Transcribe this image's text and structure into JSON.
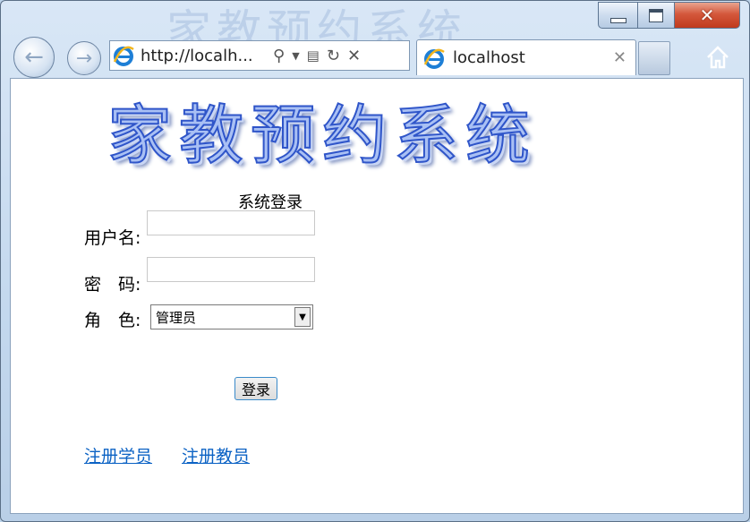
{
  "window": {
    "ghost_title": "家教预约系统",
    "controls": {
      "minimize": "minimize",
      "maximize": "maximize",
      "close": "✕"
    }
  },
  "browser": {
    "address": "http://localh...",
    "tab_title": "localhost",
    "icons": [
      "back-arrow-icon",
      "forward-arrow-icon",
      "ie-logo-icon",
      "search-icon",
      "dropdown-icon",
      "compatibility-icon",
      "refresh-icon",
      "stop-icon",
      "close-icon",
      "home-icon"
    ]
  },
  "page": {
    "banner": "家教预约系统",
    "login_title": "系统登录",
    "username_label": "用户名:",
    "password_label": "密　码:",
    "role_label": "角　色:",
    "username_value": "",
    "password_value": "",
    "role_selected": "管理员",
    "login_button": "登录",
    "links": [
      "注册学员",
      "注册教员"
    ]
  },
  "colors": {
    "banner_fill": "#a9c0f4",
    "banner_stroke": "#2f55c9",
    "link": "#0b62c4",
    "close_button": "#c03a1d"
  }
}
